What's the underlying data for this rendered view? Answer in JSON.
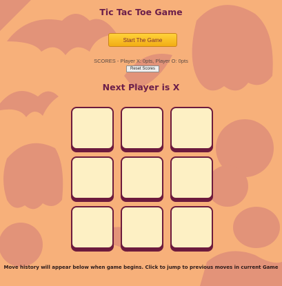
{
  "title": "Tic Tac Toe Game",
  "start_button_label": "Start The Game",
  "scores_text": "SCORES - Player X: 0pts, Player O: 0pts",
  "reset_button_label": "Reset Scores",
  "status_text": "Next Player is X",
  "board": {
    "cells": [
      "",
      "",
      "",
      "",
      "",
      "",
      "",
      "",
      ""
    ]
  },
  "history_hint": "Move history will appear below when game begins. Click to jump to previous moves in current Game",
  "colors": {
    "background": "#f7b07a",
    "decoration": "#dc8a79",
    "heading": "#6b1e4a",
    "cell_fill": "#fdf0c4",
    "cell_border": "#6d1b3d",
    "start_button": "#f6b91d"
  }
}
